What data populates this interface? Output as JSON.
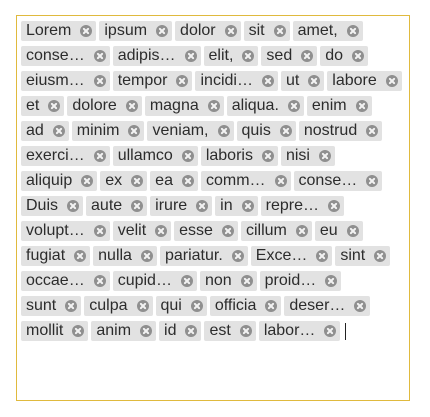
{
  "tag_input": {
    "value": "",
    "tags": [
      "Lorem",
      "ipsum",
      "dolor",
      "sit",
      "amet,",
      "conse…",
      "adipis…",
      "elit,",
      "sed",
      "do",
      "eiusm…",
      "tempor",
      "incidi…",
      "ut",
      "labore",
      "et",
      "dolore",
      "magna",
      "aliqua.",
      "enim",
      "ad",
      "minim",
      "veniam,",
      "quis",
      "nostrud",
      "exerci…",
      "ullamco",
      "laboris",
      "nisi",
      "aliquip",
      "ex",
      "ea",
      "comm…",
      "conse…",
      "Duis",
      "aute",
      "irure",
      "in",
      "repre…",
      "volupt…",
      "velit",
      "esse",
      "cillum",
      "eu",
      "fugiat",
      "nulla",
      "pariatur.",
      "Exce…",
      "sint",
      "occae…",
      "cupid…",
      "non",
      "proid…",
      "sunt",
      "culpa",
      "qui",
      "officia",
      "deser…",
      "mollit",
      "anim",
      "id",
      "est",
      "labor…"
    ],
    "remove_icon": "close-circle-icon",
    "colors": {
      "border": "#e0ba3e",
      "tag_background": "#e2e2e2",
      "tag_text": "#2c2c2c",
      "remove_icon": "#8f8f8f"
    }
  }
}
